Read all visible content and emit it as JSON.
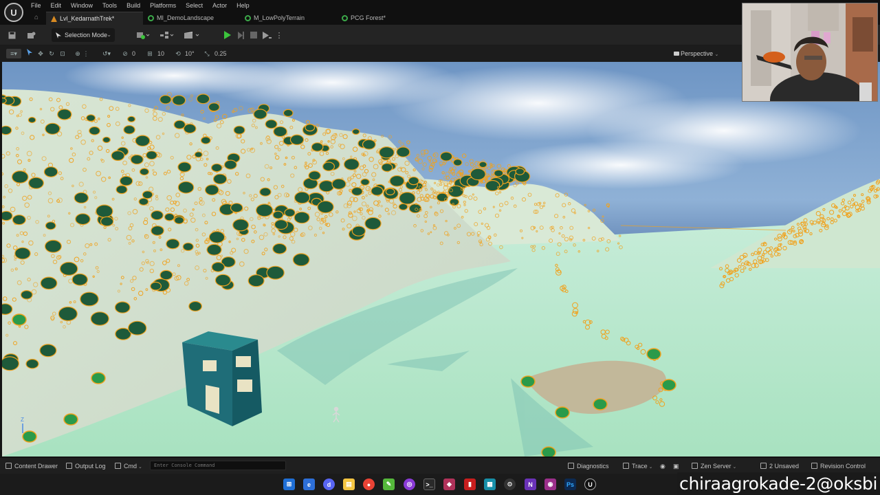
{
  "menu": [
    "File",
    "Edit",
    "Window",
    "Tools",
    "Build",
    "Platforms",
    "Select",
    "Actor",
    "Help"
  ],
  "tabs": [
    {
      "label": "Lvl_KedarnathTrek*",
      "type": "level",
      "active": true
    },
    {
      "label": "MI_DemoLandscape",
      "type": "material",
      "active": false
    },
    {
      "label": "M_LowPolyTerrain",
      "type": "material",
      "active": false
    },
    {
      "label": "PCG Forest*",
      "type": "pcg",
      "active": false
    }
  ],
  "toolbar": {
    "mode_label": "Selection Mode"
  },
  "viewport_toolbar": {
    "rotation_snap_value": "0",
    "grid_snap_value": "10",
    "angle_snap_value": "10°",
    "scale_snap_value": "0.25",
    "view_mode_label": "Perspective"
  },
  "statusbar": {
    "content_drawer_label": "Content Drawer",
    "output_log_label": "Output Log",
    "cmd_label": "Cmd",
    "console_placeholder": "Enter Console Command",
    "diagnostics_label": "Diagnostics",
    "trace_label": "Trace",
    "zen_server_label": "Zen Server",
    "unsaved_label": "2 Unsaved",
    "revision_control_label": "Revision Control"
  },
  "overlay_watermark": "chiraagrokade-2@oksbi",
  "colors": {
    "accent_orange": "#f0a21e",
    "tree_green": "#1e5a3a",
    "terrain_light": "#b8e6c8",
    "sky_blue": "#4a6fa5",
    "cube_teal": "#1f6d78",
    "play_green": "#3cc43c"
  },
  "icons": [
    "unreal-logo-icon",
    "home-icon",
    "save-icon",
    "content-icon",
    "add-actor-icon",
    "blueprint-icon",
    "cinematics-icon",
    "play-icon",
    "step-icon",
    "stop-icon",
    "eject-icon",
    "select-icon",
    "translate-icon",
    "rotate-icon",
    "scale-icon",
    "world-icon",
    "camera-icon"
  ]
}
